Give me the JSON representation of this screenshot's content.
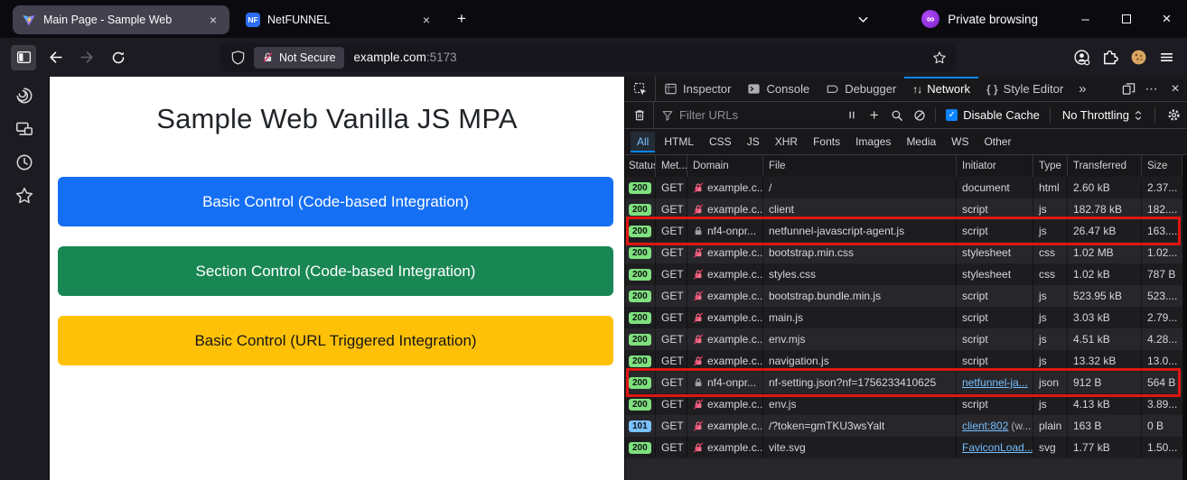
{
  "window": {
    "tabs": [
      {
        "title": "Main Page - Sample Web",
        "icon": "vite-logo"
      },
      {
        "title": "NetFUNNEL",
        "icon": "nf-logo",
        "icon_text": "NF"
      }
    ],
    "new_tab_label": "+",
    "private_label": "Private browsing",
    "controls": {
      "minimize": "–",
      "close": "×"
    }
  },
  "toolbar": {
    "security_chip": "Not Secure",
    "url_host": "example.com",
    "url_port": ":5173"
  },
  "page": {
    "title": "Sample Web Vanilla JS MPA",
    "buttons": [
      {
        "label": "Basic Control (Code-based Integration)",
        "color": "#156ff5",
        "text_color": "#ffffff"
      },
      {
        "label": "Section Control (Code-based Integration)",
        "color": "#198754",
        "text_color": "#ffffff"
      },
      {
        "label": "Basic Control (URL Triggered Integration)",
        "color": "#ffc107",
        "text_color": "#161616"
      }
    ]
  },
  "devtools": {
    "tabs": [
      "Inspector",
      "Console",
      "Debugger",
      "Network",
      "Style Editor"
    ],
    "active_tab": "Network",
    "more_tabs_glyph": "»",
    "style_editor_glyph": "{ }",
    "network_glyph": "↑↓",
    "menu_dots_glyph": "⋯",
    "close_glyph": "×",
    "toolbar": {
      "filter_placeholder": "Filter URLs",
      "disable_cache_label": "Disable Cache",
      "throttling_label": "No Throttling",
      "checkbox_check": "✓",
      "plus_glyph": "+"
    },
    "filters": [
      "All",
      "HTML",
      "CSS",
      "JS",
      "XHR",
      "Fonts",
      "Images",
      "Media",
      "WS",
      "Other"
    ],
    "active_filter": "All",
    "table": {
      "columns": [
        "Status",
        "Met...",
        "Domain",
        "File",
        "Initiator",
        "Type",
        "Transferred",
        "Size"
      ],
      "rows": [
        {
          "status": "200",
          "method": "GET",
          "domain": "example.c...",
          "lock": "insecure",
          "file": "/",
          "initiator": "document",
          "initiator_link": false,
          "initiator_suffix": "",
          "type": "html",
          "transferred": "2.60 kB",
          "size": "2.37...",
          "highlighted": false
        },
        {
          "status": "200",
          "method": "GET",
          "domain": "example.c...",
          "lock": "insecure",
          "file": "client",
          "initiator": "script",
          "initiator_link": false,
          "initiator_suffix": "",
          "type": "js",
          "transferred": "182.78 kB",
          "size": "182....",
          "highlighted": false
        },
        {
          "status": "200",
          "method": "GET",
          "domain": "nf4-onpr...",
          "lock": "secure",
          "file": "netfunnel-javascript-agent.js",
          "initiator": "script",
          "initiator_link": false,
          "initiator_suffix": "",
          "type": "js",
          "transferred": "26.47 kB",
          "size": "163....",
          "highlighted": true
        },
        {
          "status": "200",
          "method": "GET",
          "domain": "example.c...",
          "lock": "insecure",
          "file": "bootstrap.min.css",
          "initiator": "stylesheet",
          "initiator_link": false,
          "initiator_suffix": "",
          "type": "css",
          "transferred": "1.02 MB",
          "size": "1.02...",
          "highlighted": false
        },
        {
          "status": "200",
          "method": "GET",
          "domain": "example.c...",
          "lock": "insecure",
          "file": "styles.css",
          "initiator": "stylesheet",
          "initiator_link": false,
          "initiator_suffix": "",
          "type": "css",
          "transferred": "1.02 kB",
          "size": "787 B",
          "highlighted": false
        },
        {
          "status": "200",
          "method": "GET",
          "domain": "example.c...",
          "lock": "insecure",
          "file": "bootstrap.bundle.min.js",
          "initiator": "script",
          "initiator_link": false,
          "initiator_suffix": "",
          "type": "js",
          "transferred": "523.95 kB",
          "size": "523....",
          "highlighted": false
        },
        {
          "status": "200",
          "method": "GET",
          "domain": "example.c...",
          "lock": "insecure",
          "file": "main.js",
          "initiator": "script",
          "initiator_link": false,
          "initiator_suffix": "",
          "type": "js",
          "transferred": "3.03 kB",
          "size": "2.79...",
          "highlighted": false
        },
        {
          "status": "200",
          "method": "GET",
          "domain": "example.c...",
          "lock": "insecure",
          "file": "env.mjs",
          "initiator": "script",
          "initiator_link": false,
          "initiator_suffix": "",
          "type": "js",
          "transferred": "4.51 kB",
          "size": "4.28...",
          "highlighted": false
        },
        {
          "status": "200",
          "method": "GET",
          "domain": "example.c...",
          "lock": "insecure",
          "file": "navigation.js",
          "initiator": "script",
          "initiator_link": false,
          "initiator_suffix": "",
          "type": "js",
          "transferred": "13.32 kB",
          "size": "13.0...",
          "highlighted": false
        },
        {
          "status": "200",
          "method": "GET",
          "domain": "nf4-onpr...",
          "lock": "secure",
          "file": "nf-setting.json?nf=1756233410625",
          "initiator": "netfunnel-ja...",
          "initiator_link": true,
          "initiator_suffix": "",
          "type": "json",
          "transferred": "912 B",
          "size": "564 B",
          "highlighted": true
        },
        {
          "status": "200",
          "method": "GET",
          "domain": "example.c...",
          "lock": "insecure",
          "file": "env.js",
          "initiator": "script",
          "initiator_link": false,
          "initiator_suffix": "",
          "type": "js",
          "transferred": "4.13 kB",
          "size": "3.89...",
          "highlighted": false
        },
        {
          "status": "101",
          "method": "GET",
          "domain": "example.c...",
          "lock": "insecure",
          "file": "/?token=gmTKU3wsYalt",
          "initiator": "client:802",
          "initiator_link": true,
          "initiator_suffix": "(w...",
          "type": "plain",
          "transferred": "163 B",
          "size": "0 B",
          "highlighted": false
        },
        {
          "status": "200",
          "method": "GET",
          "domain": "example.c...",
          "lock": "insecure",
          "file": "vite.svg",
          "initiator": "FaviconLoad...",
          "initiator_link": true,
          "initiator_suffix": "",
          "type": "svg",
          "transferred": "1.77 kB",
          "size": "1.50...",
          "highlighted": false
        }
      ]
    }
  },
  "colors": {
    "accent_blue": "#0a84ff",
    "link_blue": "#75bfff",
    "status_ok_green": "#7ee07e",
    "status_switch_blue": "#79c0ff",
    "annotation_red": "#df1612",
    "private_purple": "#8f2de0"
  }
}
